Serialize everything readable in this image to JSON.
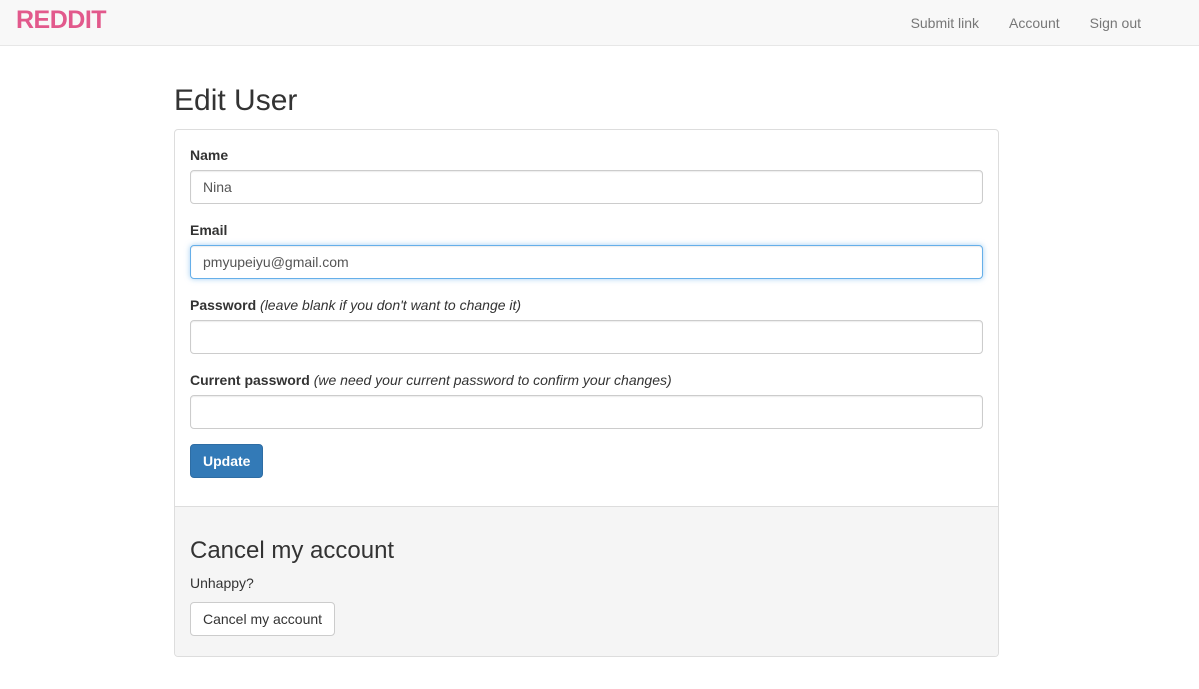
{
  "navbar": {
    "brand": "REDDIT",
    "links": [
      "Submit link",
      "Account",
      "Sign out"
    ]
  },
  "page": {
    "title": "Edit User"
  },
  "form": {
    "name": {
      "label": "Name",
      "value": "Nina"
    },
    "email": {
      "label": "Email",
      "value": "pmyupeiyu@gmail.com"
    },
    "password": {
      "label": "Password",
      "hint": "(leave blank if you don't want to change it)",
      "value": ""
    },
    "current_password": {
      "label": "Current password",
      "hint": "(we need your current password to confirm your changes)",
      "value": ""
    },
    "submit_label": "Update"
  },
  "cancel_section": {
    "heading": "Cancel my account",
    "text": "Unhappy?",
    "button_label": "Cancel my account"
  },
  "colors": {
    "brand": "#e2598c",
    "primary": "#337ab7",
    "focus_border": "#66afe9"
  }
}
